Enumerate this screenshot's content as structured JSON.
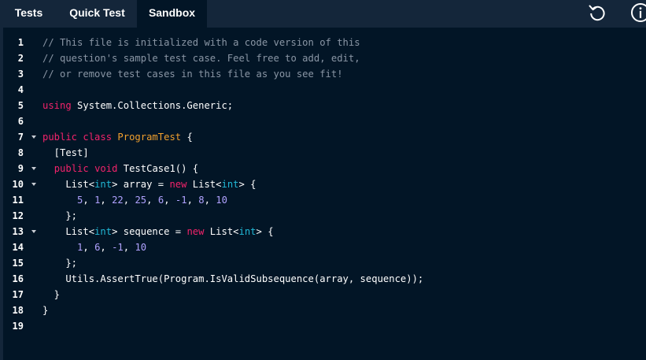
{
  "tabs": {
    "tests": "Tests",
    "quick_test": "Quick Test",
    "sandbox": "Sandbox"
  },
  "icons": {
    "reset": "reset-icon",
    "info": "info-icon"
  },
  "colors": {
    "topbar": "#14263a",
    "editor_bg": "#021526",
    "comment": "#8a96a5",
    "keyword": "#f3236b",
    "class_name": "#f1a02e",
    "type": "#21b8d6",
    "number": "#b0a2ff"
  },
  "editor": {
    "lines": [
      {
        "n": "1",
        "fold": false,
        "tokens": [
          {
            "t": "// This file is initialized with a code version of this",
            "c": "comment"
          }
        ]
      },
      {
        "n": "2",
        "fold": false,
        "tokens": [
          {
            "t": "// question's sample test case. Feel free to add, edit,",
            "c": "comment"
          }
        ]
      },
      {
        "n": "3",
        "fold": false,
        "tokens": [
          {
            "t": "// or remove test cases in this file as you see fit!",
            "c": "comment"
          }
        ]
      },
      {
        "n": "4",
        "fold": false,
        "tokens": []
      },
      {
        "n": "5",
        "fold": false,
        "tokens": [
          {
            "t": "using",
            "c": "kw"
          },
          {
            "t": " System.Collections.Generic;",
            "c": "plain"
          }
        ]
      },
      {
        "n": "6",
        "fold": false,
        "tokens": []
      },
      {
        "n": "7",
        "fold": true,
        "tokens": [
          {
            "t": "public",
            "c": "kw"
          },
          {
            "t": " ",
            "c": "plain"
          },
          {
            "t": "class",
            "c": "kw"
          },
          {
            "t": " ",
            "c": "plain"
          },
          {
            "t": "ProgramTest",
            "c": "cls"
          },
          {
            "t": " {",
            "c": "plain"
          }
        ]
      },
      {
        "n": "8",
        "fold": false,
        "tokens": [
          {
            "t": "  [Test]",
            "c": "plain"
          }
        ]
      },
      {
        "n": "9",
        "fold": true,
        "tokens": [
          {
            "t": "  ",
            "c": "plain"
          },
          {
            "t": "public",
            "c": "kw"
          },
          {
            "t": " ",
            "c": "plain"
          },
          {
            "t": "void",
            "c": "kw"
          },
          {
            "t": " TestCase1() {",
            "c": "plain"
          }
        ]
      },
      {
        "n": "10",
        "fold": true,
        "tokens": [
          {
            "t": "    List<",
            "c": "plain"
          },
          {
            "t": "int",
            "c": "type"
          },
          {
            "t": "> array = ",
            "c": "plain"
          },
          {
            "t": "new",
            "c": "kw"
          },
          {
            "t": " List<",
            "c": "plain"
          },
          {
            "t": "int",
            "c": "type"
          },
          {
            "t": "> {",
            "c": "plain"
          }
        ]
      },
      {
        "n": "11",
        "fold": false,
        "tokens": [
          {
            "t": "      ",
            "c": "plain"
          },
          {
            "t": "5",
            "c": "num"
          },
          {
            "t": ", ",
            "c": "plain"
          },
          {
            "t": "1",
            "c": "num"
          },
          {
            "t": ", ",
            "c": "plain"
          },
          {
            "t": "22",
            "c": "num"
          },
          {
            "t": ", ",
            "c": "plain"
          },
          {
            "t": "25",
            "c": "num"
          },
          {
            "t": ", ",
            "c": "plain"
          },
          {
            "t": "6",
            "c": "num"
          },
          {
            "t": ", ",
            "c": "plain"
          },
          {
            "t": "-1",
            "c": "num"
          },
          {
            "t": ", ",
            "c": "plain"
          },
          {
            "t": "8",
            "c": "num"
          },
          {
            "t": ", ",
            "c": "plain"
          },
          {
            "t": "10",
            "c": "num"
          }
        ]
      },
      {
        "n": "12",
        "fold": false,
        "tokens": [
          {
            "t": "    };",
            "c": "plain"
          }
        ]
      },
      {
        "n": "13",
        "fold": true,
        "tokens": [
          {
            "t": "    List<",
            "c": "plain"
          },
          {
            "t": "int",
            "c": "type"
          },
          {
            "t": "> sequence = ",
            "c": "plain"
          },
          {
            "t": "new",
            "c": "kw"
          },
          {
            "t": " List<",
            "c": "plain"
          },
          {
            "t": "int",
            "c": "type"
          },
          {
            "t": "> {",
            "c": "plain"
          }
        ]
      },
      {
        "n": "14",
        "fold": false,
        "tokens": [
          {
            "t": "      ",
            "c": "plain"
          },
          {
            "t": "1",
            "c": "num"
          },
          {
            "t": ", ",
            "c": "plain"
          },
          {
            "t": "6",
            "c": "num"
          },
          {
            "t": ", ",
            "c": "plain"
          },
          {
            "t": "-1",
            "c": "num"
          },
          {
            "t": ", ",
            "c": "plain"
          },
          {
            "t": "10",
            "c": "num"
          }
        ]
      },
      {
        "n": "15",
        "fold": false,
        "tokens": [
          {
            "t": "    };",
            "c": "plain"
          }
        ]
      },
      {
        "n": "16",
        "fold": false,
        "tokens": [
          {
            "t": "    Utils.AssertTrue(Program.IsValidSubsequence(array, sequence));",
            "c": "plain"
          }
        ]
      },
      {
        "n": "17",
        "fold": false,
        "tokens": [
          {
            "t": "  }",
            "c": "plain"
          }
        ]
      },
      {
        "n": "18",
        "fold": false,
        "tokens": [
          {
            "t": "}",
            "c": "plain"
          }
        ]
      },
      {
        "n": "19",
        "fold": false,
        "tokens": []
      }
    ]
  }
}
